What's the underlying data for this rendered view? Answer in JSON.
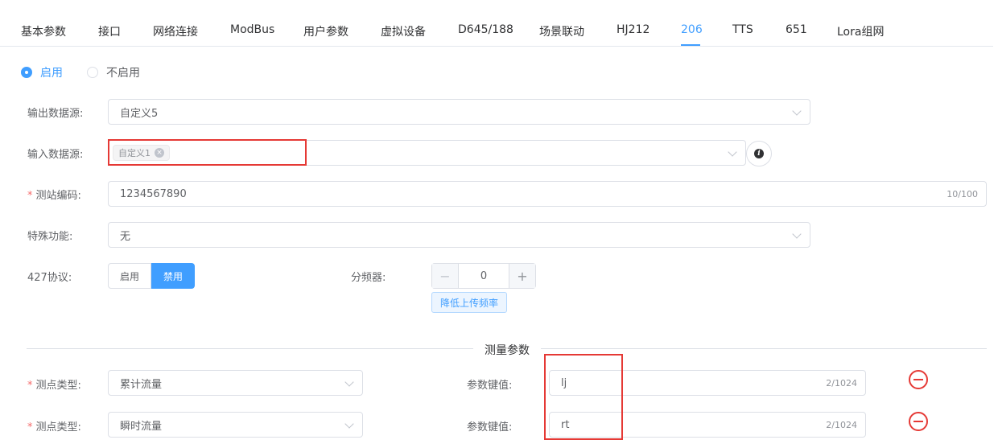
{
  "tabs": [
    {
      "label": "基本参数"
    },
    {
      "label": "接口"
    },
    {
      "label": "网络连接"
    },
    {
      "label": "ModBus"
    },
    {
      "label": "用户参数"
    },
    {
      "label": "虚拟设备"
    },
    {
      "label": "D645/188"
    },
    {
      "label": "场景联动"
    },
    {
      "label": "HJ212"
    },
    {
      "label": "206"
    },
    {
      "label": "TTS"
    },
    {
      "label": "651"
    },
    {
      "label": "Lora组网"
    }
  ],
  "enable_radio": {
    "on_label": "启用",
    "off_label": "不启用",
    "selected": "启用"
  },
  "output_source": {
    "label": "输出数据源:",
    "value": "自定义5"
  },
  "input_source": {
    "label": "输入数据源:",
    "tag": "自定义1",
    "tag_close": "×",
    "info_icon": "i"
  },
  "station_code": {
    "required_mark": "*",
    "label": "测站编码:",
    "value": "1234567890",
    "counter": "10/100"
  },
  "special_function": {
    "label": "特殊功能:",
    "value": "无"
  },
  "protocol_427": {
    "label": "427协议:",
    "enable_label": "启用",
    "disable_label": "禁用",
    "selected": "禁用"
  },
  "divider_freq": {
    "label": "分频器:",
    "value": "0",
    "minus": "−",
    "plus": "+",
    "hint_button": "降低上传频率"
  },
  "measure_section": {
    "title": "测量参数"
  },
  "measure_rows": [
    {
      "required_mark": "*",
      "type_label": "测点类型:",
      "type_value": "累计流量",
      "key_label": "参数键值:",
      "key_value": "lj",
      "counter": "2/1024"
    },
    {
      "required_mark": "*",
      "type_label": "测点类型:",
      "type_value": "瞬时流量",
      "key_label": "参数键值:",
      "key_value": "rt",
      "counter": "2/1024"
    }
  ],
  "colors": {
    "primary": "#409eff",
    "highlight_box": "#e53935"
  }
}
